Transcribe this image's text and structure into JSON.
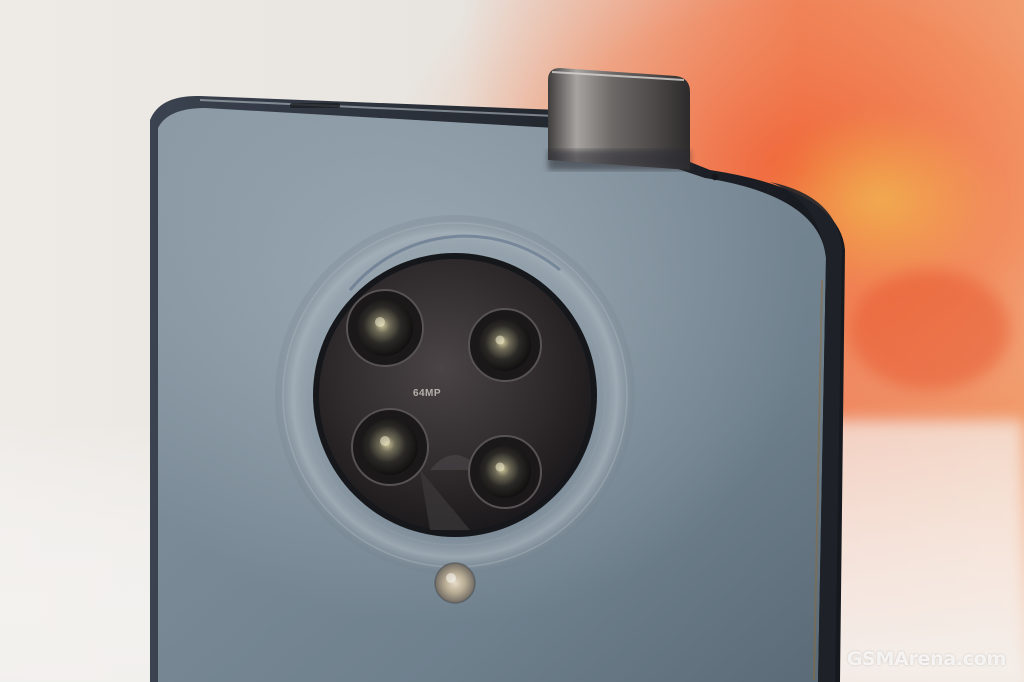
{
  "photo": {
    "subject": "smartphone-rear-with-popup-selfie-camera",
    "camera_module_label": "64MP",
    "watermark_text": "GSMArena.com",
    "colors": {
      "phone_body": "#7d8d98",
      "phone_frame": "#2d3239",
      "camera_island": "#2a2628",
      "popup_camera": "#5f5c5a",
      "background_left": "#eeeae5",
      "background_right_accent": "#e9603a"
    }
  }
}
